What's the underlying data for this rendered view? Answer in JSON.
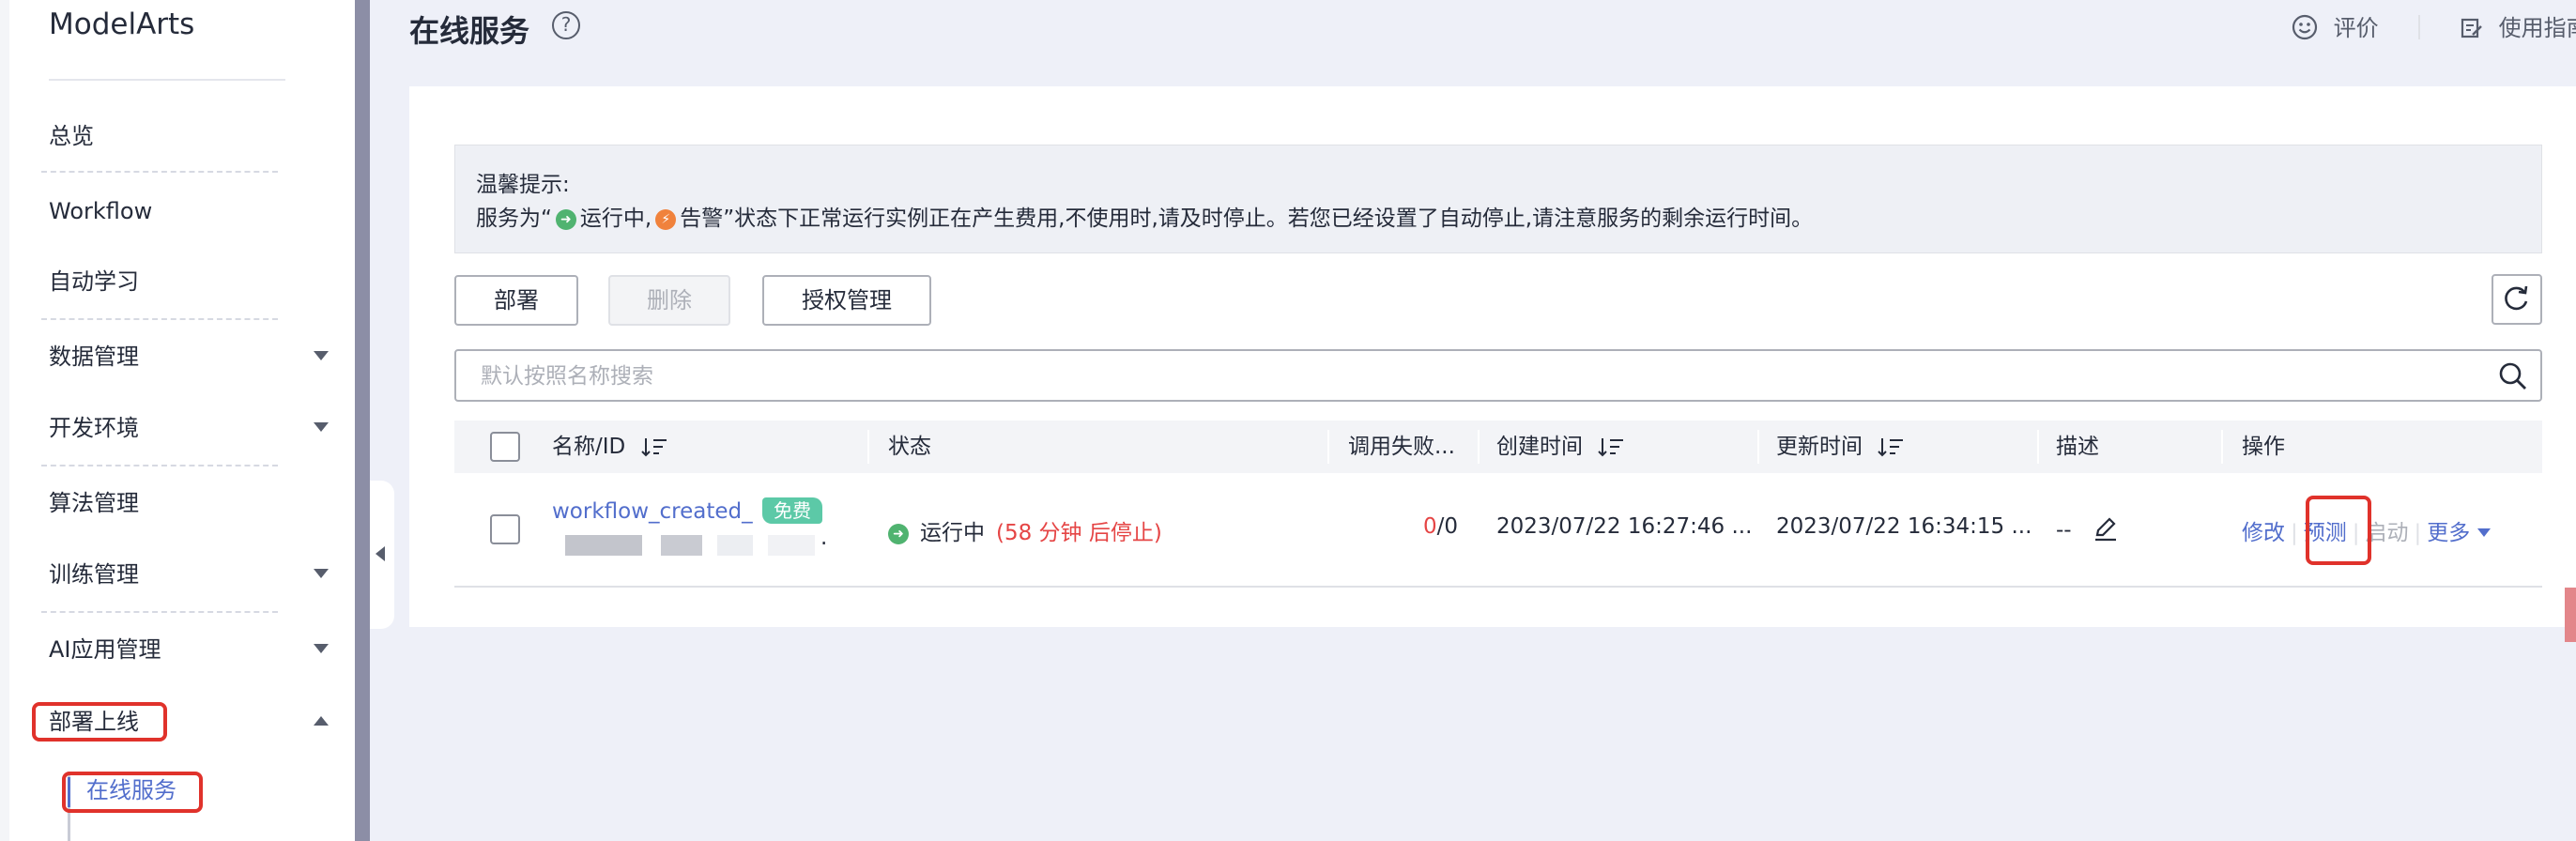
{
  "sidebar": {
    "brand": "ModelArts",
    "items": [
      {
        "label": "总览"
      },
      {
        "label": "Workflow"
      },
      {
        "label": "自动学习"
      },
      {
        "label": "数据管理"
      },
      {
        "label": "开发环境"
      },
      {
        "label": "算法管理"
      },
      {
        "label": "训练管理"
      },
      {
        "label": "AI应用管理"
      },
      {
        "label": "部署上线"
      }
    ],
    "sub_item": "在线服务"
  },
  "header": {
    "title": "在线服务",
    "help": "?",
    "rate_label": "评价",
    "guide_label": "使用指南"
  },
  "notice": {
    "title": "温馨提示:",
    "prefix": "服务为“",
    "running": "运行中,",
    "alarm": "告警",
    "suffix": "”状态下正常运行实例正在产生费用,不使用时,请及时停止。若您已经设置了自动停止,请注意服务的剩余运行时间。"
  },
  "toolbar": {
    "deploy": "部署",
    "delete": "删除",
    "auth": "授权管理"
  },
  "search": {
    "placeholder": "默认按照名称搜索"
  },
  "table": {
    "columns": [
      "名称/ID",
      "状态",
      "调用失败...",
      "创建时间",
      "更新时间",
      "描述",
      "操作"
    ],
    "row": {
      "name": "workflow_created_",
      "badge": "免费",
      "id_tail": ".",
      "status": "运行中",
      "status_note": "(58 分钟 后停止)",
      "fail_count": "0",
      "total_count": "/0",
      "created": "2023/07/22 16:27:46 ...",
      "updated": "2023/07/22 16:34:15 ...",
      "desc": "--",
      "actions": {
        "modify": "修改",
        "predict": "预测",
        "start": "启动",
        "more": "更多"
      }
    }
  },
  "colors": {
    "accent": "#526ecc",
    "highlight": "#e0322b",
    "running": "#50b370",
    "alarm": "#f0823c",
    "warning_text": "#e54545"
  }
}
